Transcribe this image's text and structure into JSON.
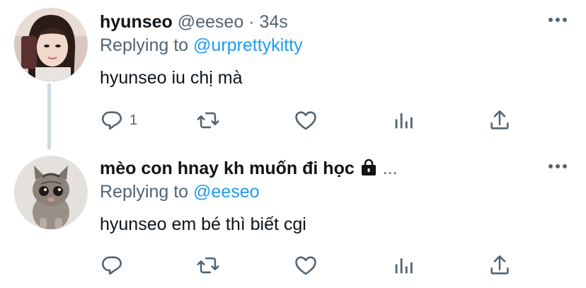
{
  "tweets": [
    {
      "name": "hyunseo",
      "handle": "@eeseo",
      "separator": "·",
      "time": "34s",
      "replying_prefix": "Replying to",
      "replying_to": "@urprettykitty",
      "text": "hyunseo iu chị mà",
      "reply_count": "1",
      "more_icon": "more-horizontal-icon",
      "action_icons": [
        "reply-icon",
        "retweet-icon",
        "like-icon",
        "analytics-icon",
        "share-icon"
      ]
    },
    {
      "name": "mèo con hnay kh muốn đi học",
      "locked_icon": "lock-icon",
      "name_ellipsis": "...",
      "replying_prefix": "Replying to",
      "replying_to": "@eeseo",
      "text": "hyunseo em bé thì biết cgi",
      "reply_count": "",
      "more_icon": "more-horizontal-icon",
      "action_icons": [
        "reply-icon",
        "retweet-icon",
        "like-icon",
        "analytics-icon",
        "share-icon"
      ]
    }
  ],
  "colors": {
    "text_primary": "#0f1419",
    "text_secondary": "#536471",
    "link": "#1d9bf0",
    "thread_line": "#cfd9de"
  }
}
